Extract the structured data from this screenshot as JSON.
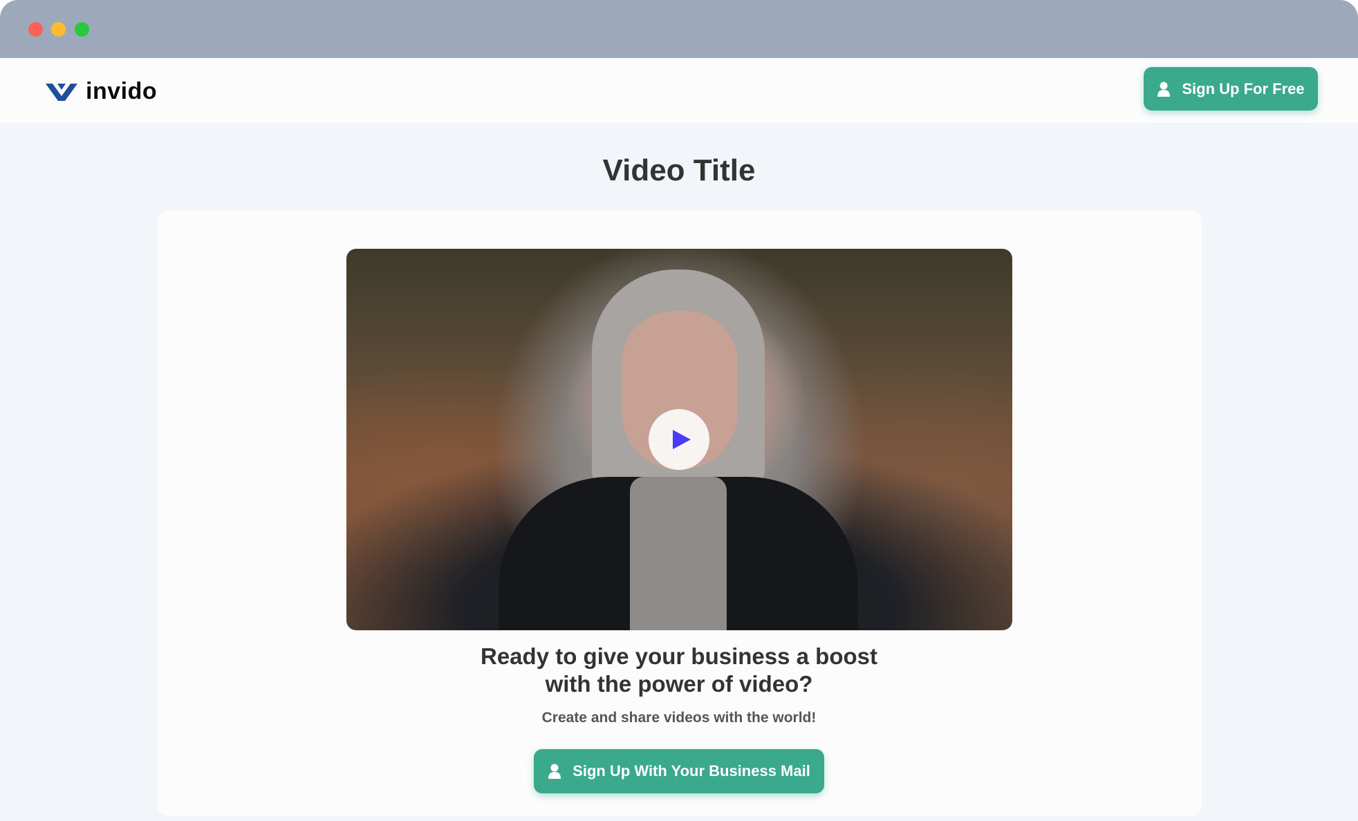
{
  "window": {
    "controls": [
      "close",
      "minimize",
      "maximize"
    ]
  },
  "header": {
    "logo_text": "invido",
    "logo_icon": "invido-logo-icon",
    "signup_label": "Sign Up For Free",
    "signup_icon": "user-icon"
  },
  "main": {
    "title": "Video Title",
    "video": {
      "play_icon": "play-icon"
    },
    "headline_line1": "Ready to give your business a boost",
    "headline_line2": "with the power of video?",
    "subline": "Create and share videos with the world!",
    "cta_label": "Sign Up With Your Business Mail",
    "cta_icon": "user-icon"
  },
  "colors": {
    "accent": "#3aa98c",
    "titlebar": "#9da9bb",
    "background": "#f2f5f9",
    "play_icon": "#4b3bf5",
    "logo": "#1e4f9c"
  }
}
